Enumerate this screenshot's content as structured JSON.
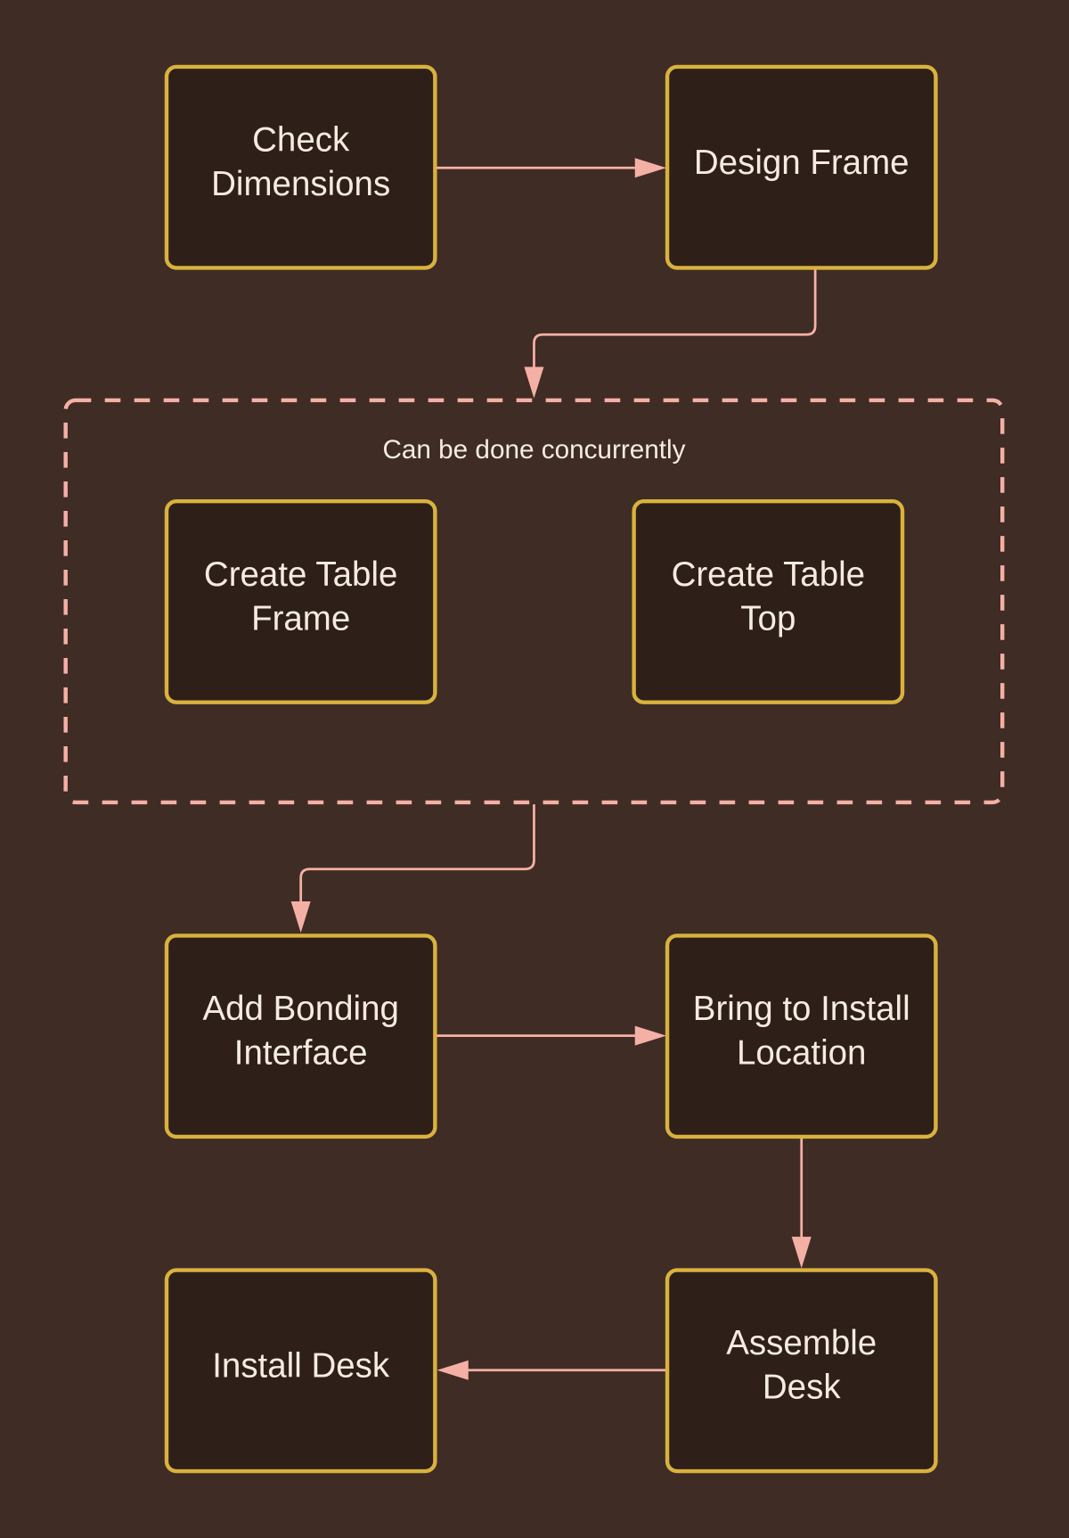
{
  "diagram": {
    "background": "#3f2c25",
    "colors": {
      "node_fill": "#2e1f19",
      "node_border": "#d9b23d",
      "edge": "#f5b0a5",
      "text": "#f5ecdf"
    },
    "group": {
      "id": "concurrent",
      "label": "Can be done concurrently"
    },
    "nodes": [
      {
        "id": "check",
        "lines": [
          "Check",
          "Dimensions"
        ]
      },
      {
        "id": "design",
        "lines": [
          "Design Frame"
        ]
      },
      {
        "id": "frame",
        "lines": [
          "Create Table",
          "Frame"
        ]
      },
      {
        "id": "top",
        "lines": [
          "Create Table",
          "Top"
        ]
      },
      {
        "id": "bonding",
        "lines": [
          "Add Bonding",
          "Interface"
        ]
      },
      {
        "id": "bring",
        "lines": [
          "Bring to Install",
          "Location"
        ]
      },
      {
        "id": "assemble",
        "lines": [
          "Assemble",
          "Desk"
        ]
      },
      {
        "id": "install",
        "lines": [
          "Install Desk"
        ]
      }
    ],
    "edges": [
      {
        "from": "check",
        "to": "design"
      },
      {
        "from": "design",
        "to": "concurrent"
      },
      {
        "from": "concurrent",
        "to": "bonding"
      },
      {
        "from": "bonding",
        "to": "bring"
      },
      {
        "from": "bring",
        "to": "assemble"
      },
      {
        "from": "assemble",
        "to": "install"
      }
    ]
  }
}
